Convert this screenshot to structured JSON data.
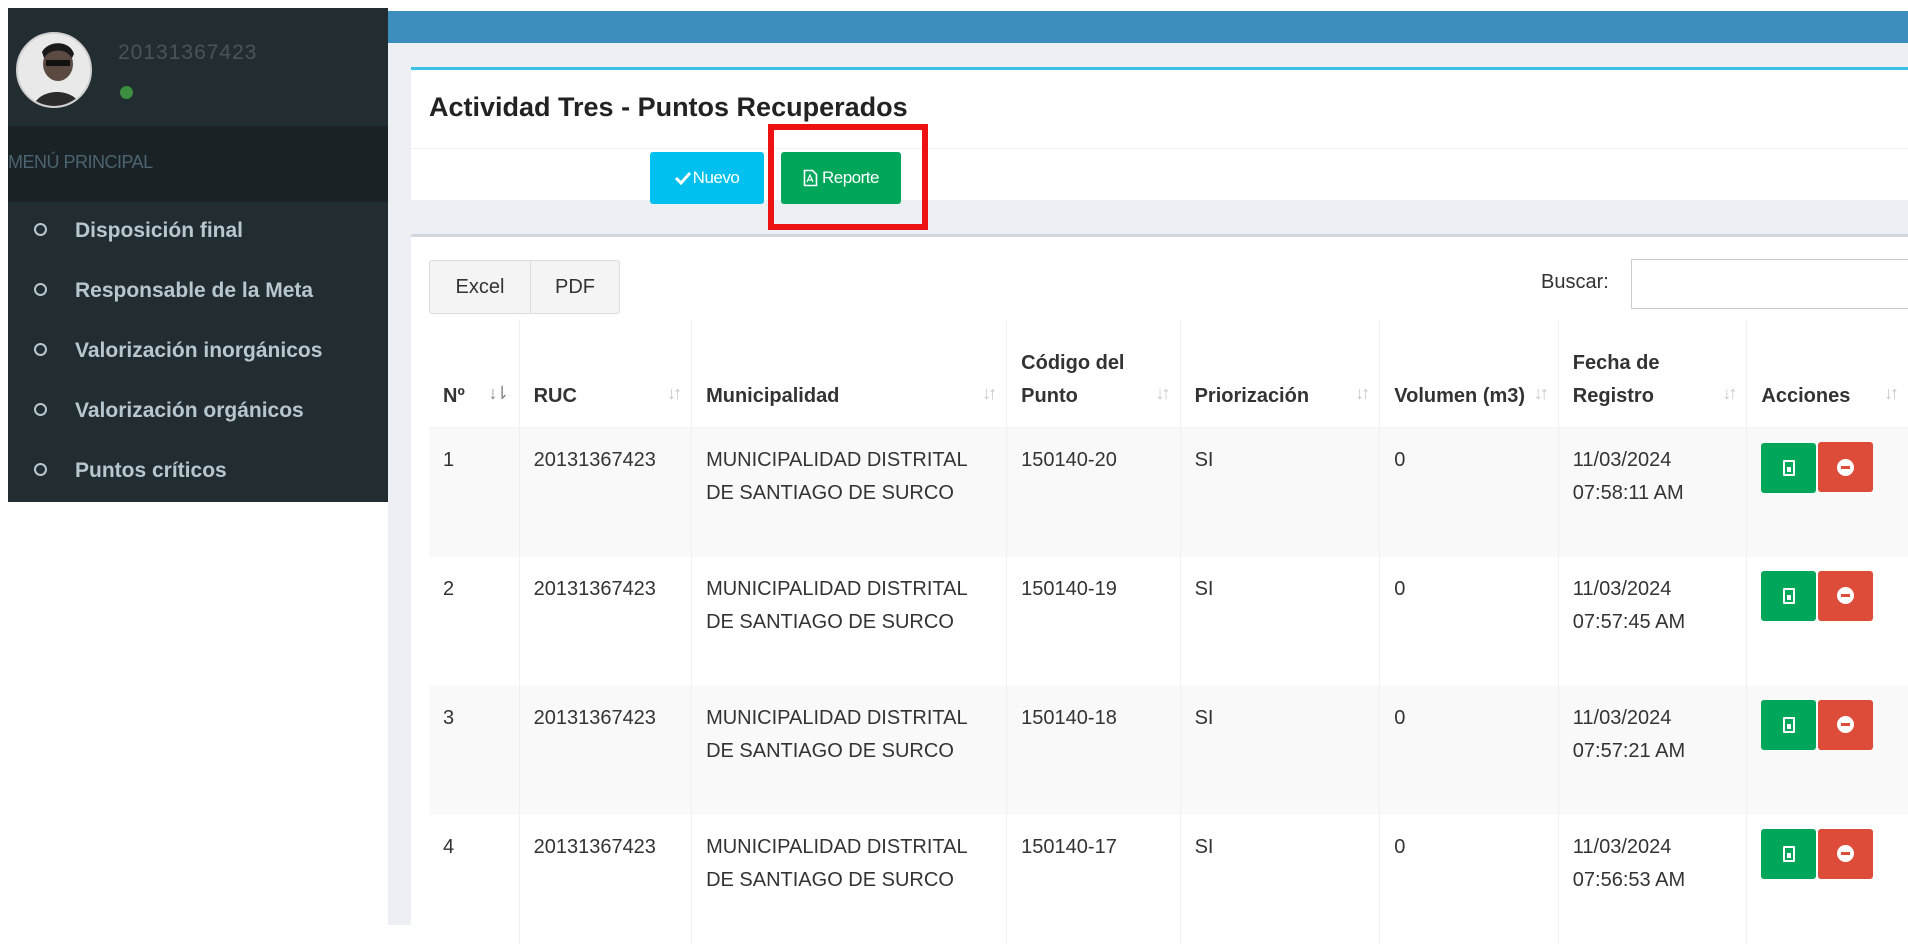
{
  "sidebar": {
    "username": "20131367423",
    "status": "online",
    "menu_header": "MENÚ PRINCIPAL",
    "items": [
      {
        "label": "Disposición final"
      },
      {
        "label": "Responsable de la Meta"
      },
      {
        "label": "Valorización inorgánicos"
      },
      {
        "label": "Valorización orgánicos"
      },
      {
        "label": "Puntos críticos"
      }
    ]
  },
  "header": {
    "title": "Actividad Tres - Puntos Recuperados",
    "nuevo_label": "Nuevo",
    "reporte_label": "Reporte"
  },
  "toolbar": {
    "excel_label": "Excel",
    "pdf_label": "PDF",
    "search_label": "Buscar:",
    "search_value": ""
  },
  "table": {
    "columns": [
      "Nº",
      "RUC",
      "Municipalidad",
      "Código del Punto",
      "Priorización",
      "Volumen (m3)",
      "Fecha de Registro",
      "Acciones"
    ],
    "rows": [
      {
        "n": "1",
        "ruc": "20131367423",
        "municipalidad": "MUNICIPALIDAD DISTRITAL DE SANTIAGO DE SURCO",
        "codigo": "150140-20",
        "priorizacion": "SI",
        "volumen": "0",
        "fecha": "11/03/2024 07:58:11 AM"
      },
      {
        "n": "2",
        "ruc": "20131367423",
        "municipalidad": "MUNICIPALIDAD DISTRITAL DE SANTIAGO DE SURCO",
        "codigo": "150140-19",
        "priorizacion": "SI",
        "volumen": "0",
        "fecha": "11/03/2024 07:57:45 AM"
      },
      {
        "n": "3",
        "ruc": "20131367423",
        "municipalidad": "MUNICIPALIDAD DISTRITAL DE SANTIAGO DE SURCO",
        "codigo": "150140-18",
        "priorizacion": "SI",
        "volumen": "0",
        "fecha": "11/03/2024 07:57:21 AM"
      },
      {
        "n": "4",
        "ruc": "20131367423",
        "municipalidad": "MUNICIPALIDAD DISTRITAL DE SANTIAGO DE SURCO",
        "codigo": "150140-17",
        "priorizacion": "SI",
        "volumen": "0",
        "fecha": "11/03/2024 07:56:53 AM"
      }
    ]
  },
  "colors": {
    "topbar": "#3c8dbc",
    "sidebar": "#222d32",
    "nuevo": "#00c0ef",
    "reporte": "#00a65a",
    "delete": "#dd4b39",
    "highlight": "#ee1111"
  }
}
